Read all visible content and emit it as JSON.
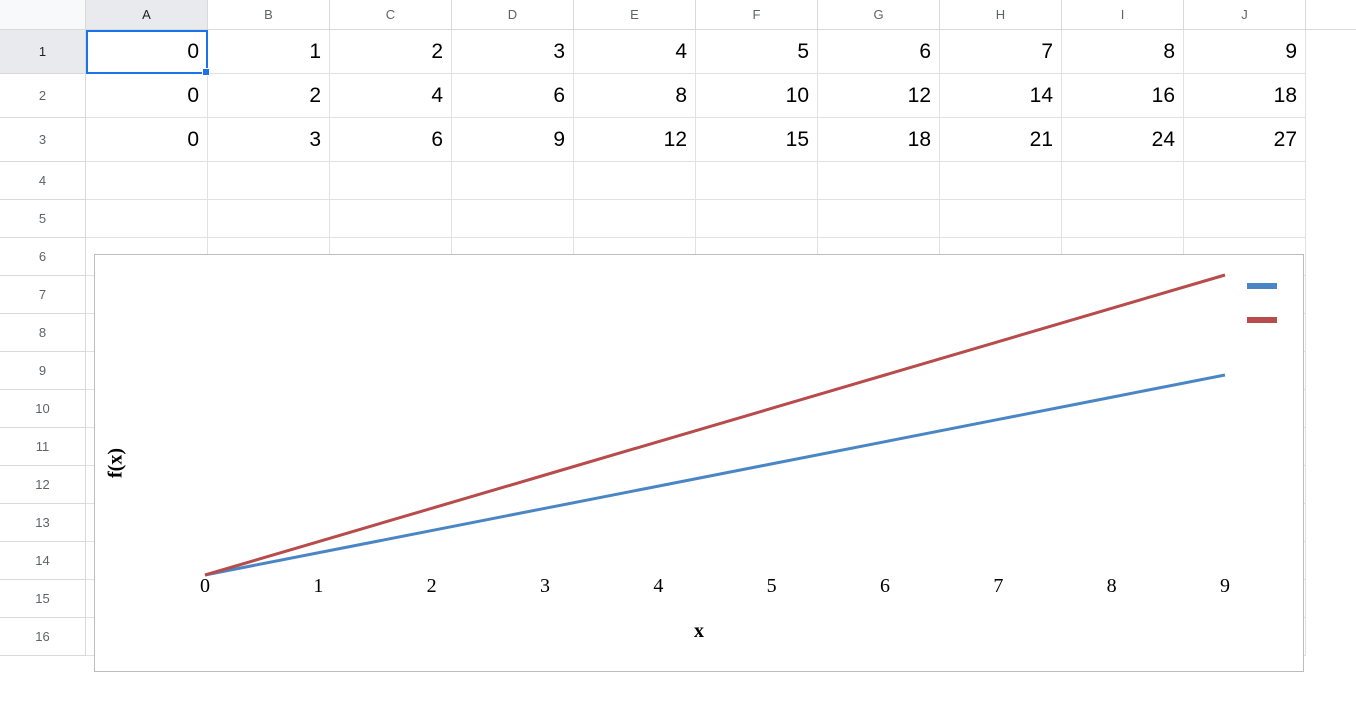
{
  "columns": [
    "A",
    "B",
    "C",
    "D",
    "E",
    "F",
    "G",
    "H",
    "I",
    "J"
  ],
  "row_count_visible": 16,
  "data_rows": 3,
  "active_cell": "A1",
  "cells": {
    "row1": [
      "0",
      "1",
      "2",
      "3",
      "4",
      "5",
      "6",
      "7",
      "8",
      "9"
    ],
    "row2": [
      "0",
      "2",
      "4",
      "6",
      "8",
      "10",
      "12",
      "14",
      "16",
      "18"
    ],
    "row3": [
      "0",
      "3",
      "6",
      "9",
      "12",
      "15",
      "18",
      "21",
      "24",
      "27"
    ]
  },
  "chart_data": {
    "type": "line",
    "x": [
      0,
      1,
      2,
      3,
      4,
      5,
      6,
      7,
      8,
      9
    ],
    "series": [
      {
        "name": "",
        "values": [
          0,
          2,
          4,
          6,
          8,
          10,
          12,
          14,
          16,
          18
        ],
        "color": "#4a86c5"
      },
      {
        "name": "",
        "values": [
          0,
          3,
          6,
          9,
          12,
          15,
          18,
          21,
          24,
          27
        ],
        "color": "#b84b4b"
      }
    ],
    "xlabel": "x",
    "ylabel": "f(x)",
    "x_ticks": [
      0,
      1,
      2,
      3,
      4,
      5,
      6,
      7,
      8,
      9
    ],
    "xlim": [
      0,
      9
    ],
    "ylim": [
      0,
      27
    ],
    "legend_position": "right"
  }
}
